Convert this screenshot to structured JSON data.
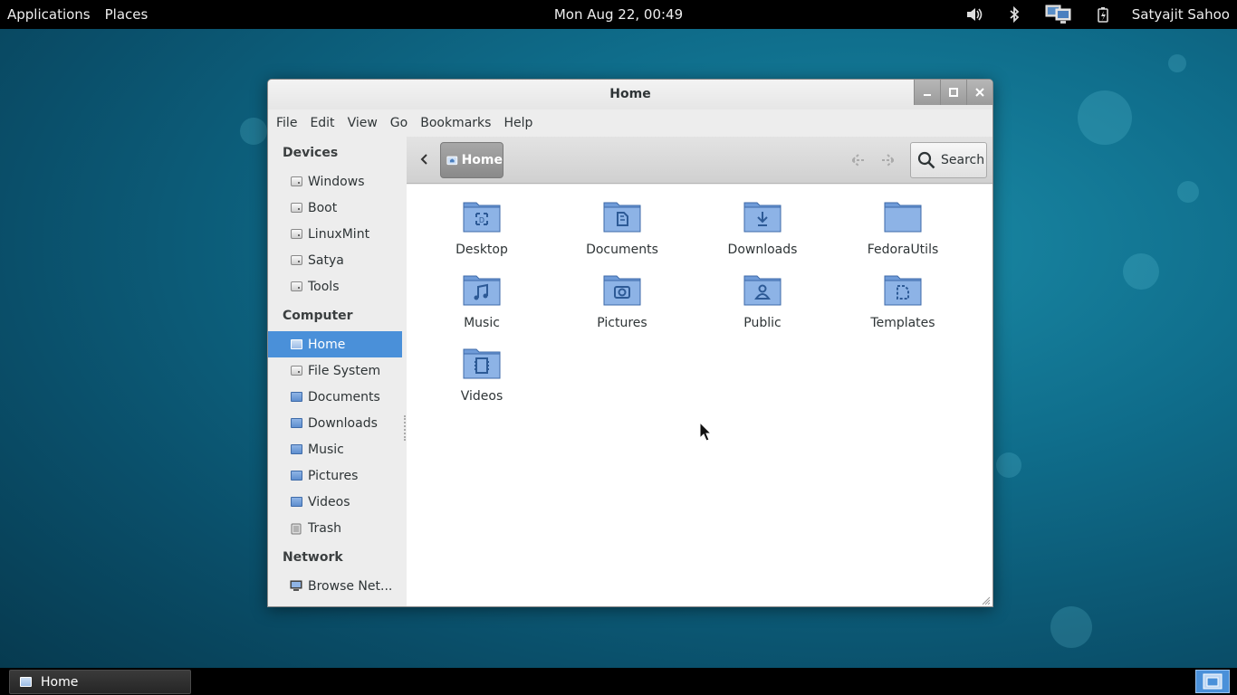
{
  "top_panel": {
    "applications": "Applications",
    "places": "Places",
    "clock": "Mon Aug 22, 00:49",
    "user": "Satyajit Sahoo",
    "tray_icons": [
      "volume-icon",
      "bluetooth-icon",
      "network-icon",
      "battery-icon"
    ]
  },
  "window": {
    "title": "Home",
    "menu": [
      "File",
      "Edit",
      "View",
      "Go",
      "Bookmarks",
      "Help"
    ]
  },
  "sidebar": {
    "devices_heading": "Devices",
    "devices": [
      "Windows",
      "Boot",
      "LinuxMint",
      "Satya",
      "Tools"
    ],
    "computer_heading": "Computer",
    "computer": [
      "Home",
      "File System",
      "Documents",
      "Downloads",
      "Music",
      "Pictures",
      "Videos",
      "Trash"
    ],
    "selected": "Home",
    "network_heading": "Network",
    "network": [
      "Browse Net..."
    ]
  },
  "toolbar": {
    "path": "Home",
    "search_label": "Search"
  },
  "files": [
    "Desktop",
    "Documents",
    "Downloads",
    "FedoraUtils",
    "Music",
    "Pictures",
    "Public",
    "Templates",
    "Videos"
  ],
  "taskbar": {
    "window_button": "Home"
  },
  "colors": {
    "selection": "#4a90d9",
    "folder": "#6f9bd8",
    "panel": "#000000"
  }
}
